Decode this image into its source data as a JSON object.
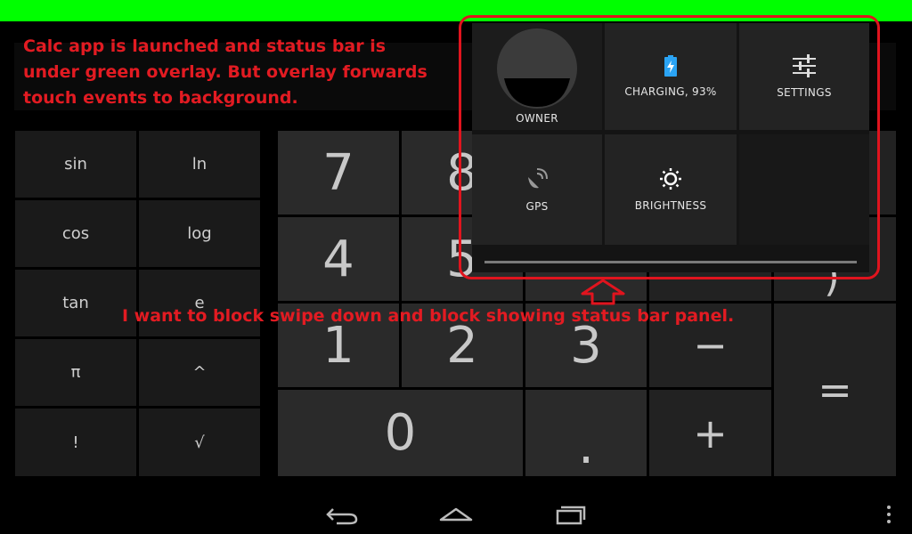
{
  "annotations": {
    "top": "Calc app is launched and status bar is under green overlay. But overlay forwards touch events to background.",
    "bottom": "I want to block swipe down and block showing status bar panel."
  },
  "calculator": {
    "advanced_keys": [
      "sin",
      "ln",
      "cos",
      "log",
      "tan",
      "e",
      "π",
      "^",
      "!",
      "√"
    ],
    "digit_keys": [
      "7",
      "8",
      "4",
      "5",
      "1",
      "2",
      "3",
      "0",
      "."
    ],
    "operator_keys": [
      "(",
      ")",
      "−",
      "+",
      "="
    ]
  },
  "quick_settings": {
    "owner_label": "OWNER",
    "battery_label": "CHARGING, 93%",
    "settings_label": "SETTINGS",
    "gps_label": "GPS",
    "brightness_label": "BRIGHTNESS"
  },
  "navigation": {
    "back_icon": "back-icon",
    "home_icon": "home-icon",
    "recents_icon": "recents-icon",
    "menu_icon": "overflow-menu-icon"
  },
  "colors": {
    "overlay_green": "#00ff00",
    "annotation_red": "#e21b22"
  }
}
